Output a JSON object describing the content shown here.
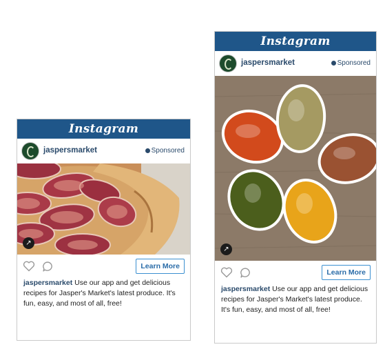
{
  "ads": [
    {
      "platform": "Instagram",
      "username": "jaspersmarket",
      "sponsored": "Sponsored",
      "cta": "Learn More",
      "caption_user": "jaspersmarket",
      "caption_text": "Use our app and get delicious recipes for Jasper's Market's latest produce. It's fun, easy, and most of all, free!"
    },
    {
      "platform": "Instagram",
      "username": "jaspersmarket",
      "sponsored": "Sponsored",
      "cta": "Learn More",
      "caption_user": "jaspersmarket",
      "caption_text": "Use our app and get delicious recipes for Jasper's Market's latest produce. It's fun, easy, and most of all, free!"
    }
  ],
  "colors": {
    "brand_bar": "#1f5689",
    "username": "#2a4a6b",
    "button_border": "#3a8fd0"
  },
  "icons": [
    "heart-icon",
    "comment-icon",
    "expand-icon",
    "sponsored-dot-icon"
  ]
}
